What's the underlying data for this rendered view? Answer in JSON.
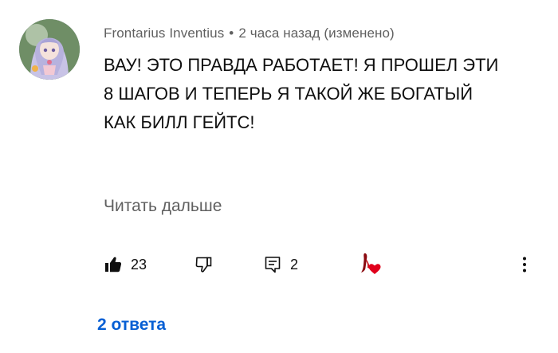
{
  "comment": {
    "author": "Frontarius Inventius",
    "separator": "•",
    "timestamp": "2 часа назад (изменено)",
    "text_lines": [
      "ВАУ! ЭТО ПРАВДА РАБОТАЕТ! Я ПРОШЕЛ ЭТИ",
      "8 ШАГОВ И ТЕПЕРЬ Я ТАКОЙ ЖЕ БОГАТЫЙ",
      "КАК БИЛЛ ГЕЙТС!"
    ],
    "read_more_label": "Читать дальше",
    "like_count": "23",
    "reply_count": "2",
    "replies_link": "2 ответа"
  },
  "icons": {
    "like": "thumbs-up-icon",
    "dislike": "thumbs-down-icon",
    "reply": "reply-comment-icon",
    "creator_heart": "creator-heart-icon",
    "more": "more-vertical-icon"
  },
  "colors": {
    "text": "#0f0f0f",
    "secondary": "#606060",
    "link": "#065fd4",
    "heart": "#e0001b"
  }
}
